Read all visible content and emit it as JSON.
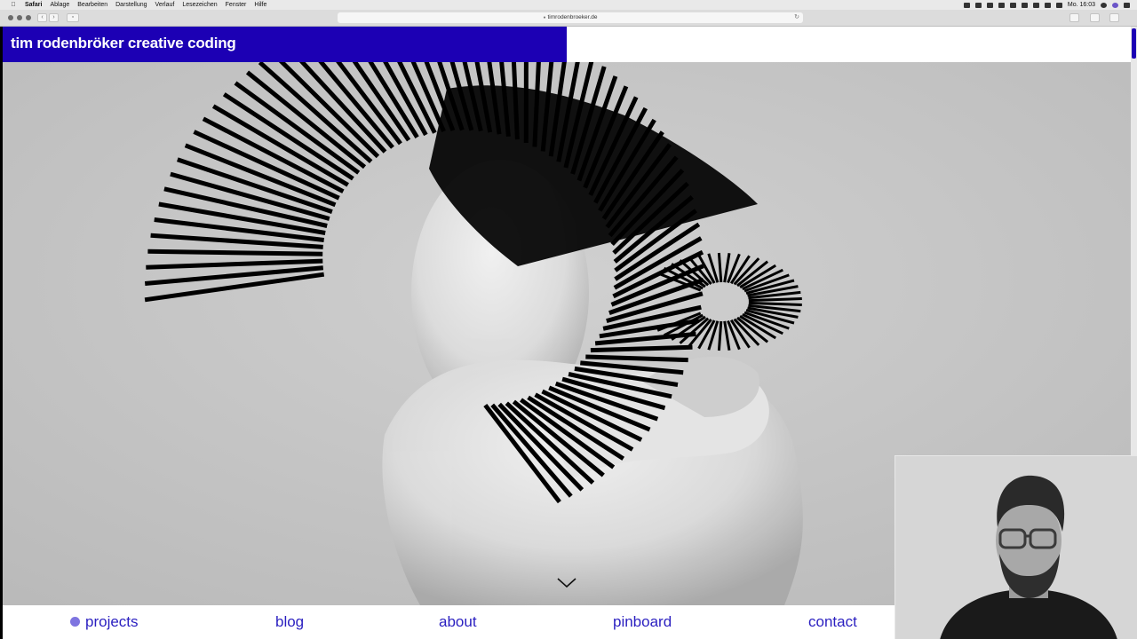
{
  "menubar": {
    "app": "Safari",
    "items": [
      "Ablage",
      "Bearbeiten",
      "Darstellung",
      "Verlauf",
      "Lesezeichen",
      "Fenster",
      "Hilfe"
    ],
    "clock": "Mo. 16:03"
  },
  "browser": {
    "url": "timrodenbroeker.de"
  },
  "site": {
    "title": "tim rodenbröker creative coding",
    "nav": [
      "projects",
      "blog",
      "about",
      "pinboard",
      "contact"
    ],
    "active_nav": "projects",
    "colors": {
      "brand": "#1c00b4",
      "nav_text": "#2a1fc0",
      "active_dot": "#7e74e0"
    }
  },
  "icons": [
    "apple-icon",
    "back-icon",
    "forward-icon",
    "sidebar-icon",
    "lock-icon",
    "reload-icon",
    "download-icon",
    "share-icon",
    "tabs-icon",
    "chevron-down-icon"
  ]
}
